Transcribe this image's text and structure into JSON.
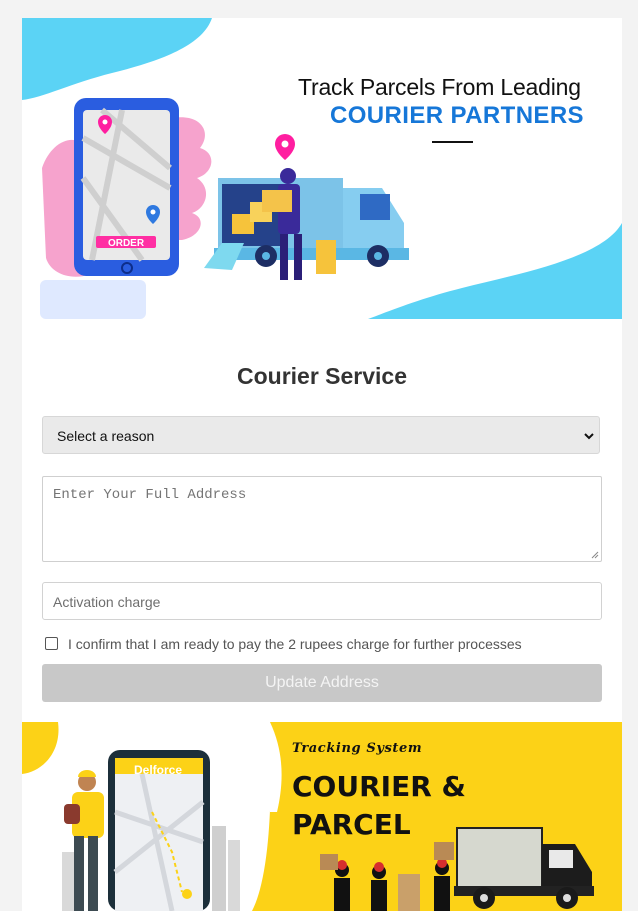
{
  "banner_top": {
    "title": "Track Parcels From Leading",
    "subtitle": "COURIER PARTNERS",
    "phone_button": "ORDER"
  },
  "form": {
    "heading": "Courier Service",
    "reason_select": {
      "selected": "Select a reason"
    },
    "address": {
      "placeholder": "Enter Your Full Address"
    },
    "activation": {
      "placeholder": "Activation charge"
    },
    "confirm_label": "I confirm that I am ready to pay the 2 rupees charge for further processes",
    "confirm_checked": false,
    "submit_label": "Update Address"
  },
  "banner_bottom": {
    "tagline": "Tracking System",
    "headline_line1": "COURIER &",
    "headline_line2": "PARCEL",
    "brand": "Delforce"
  },
  "colors": {
    "accent_blue": "#1677d8",
    "cyan_blob": "#5bd3f5",
    "pink": "#f2a0c8",
    "yellow": "#fcd217",
    "button_disabled": "#c8c8c8"
  }
}
